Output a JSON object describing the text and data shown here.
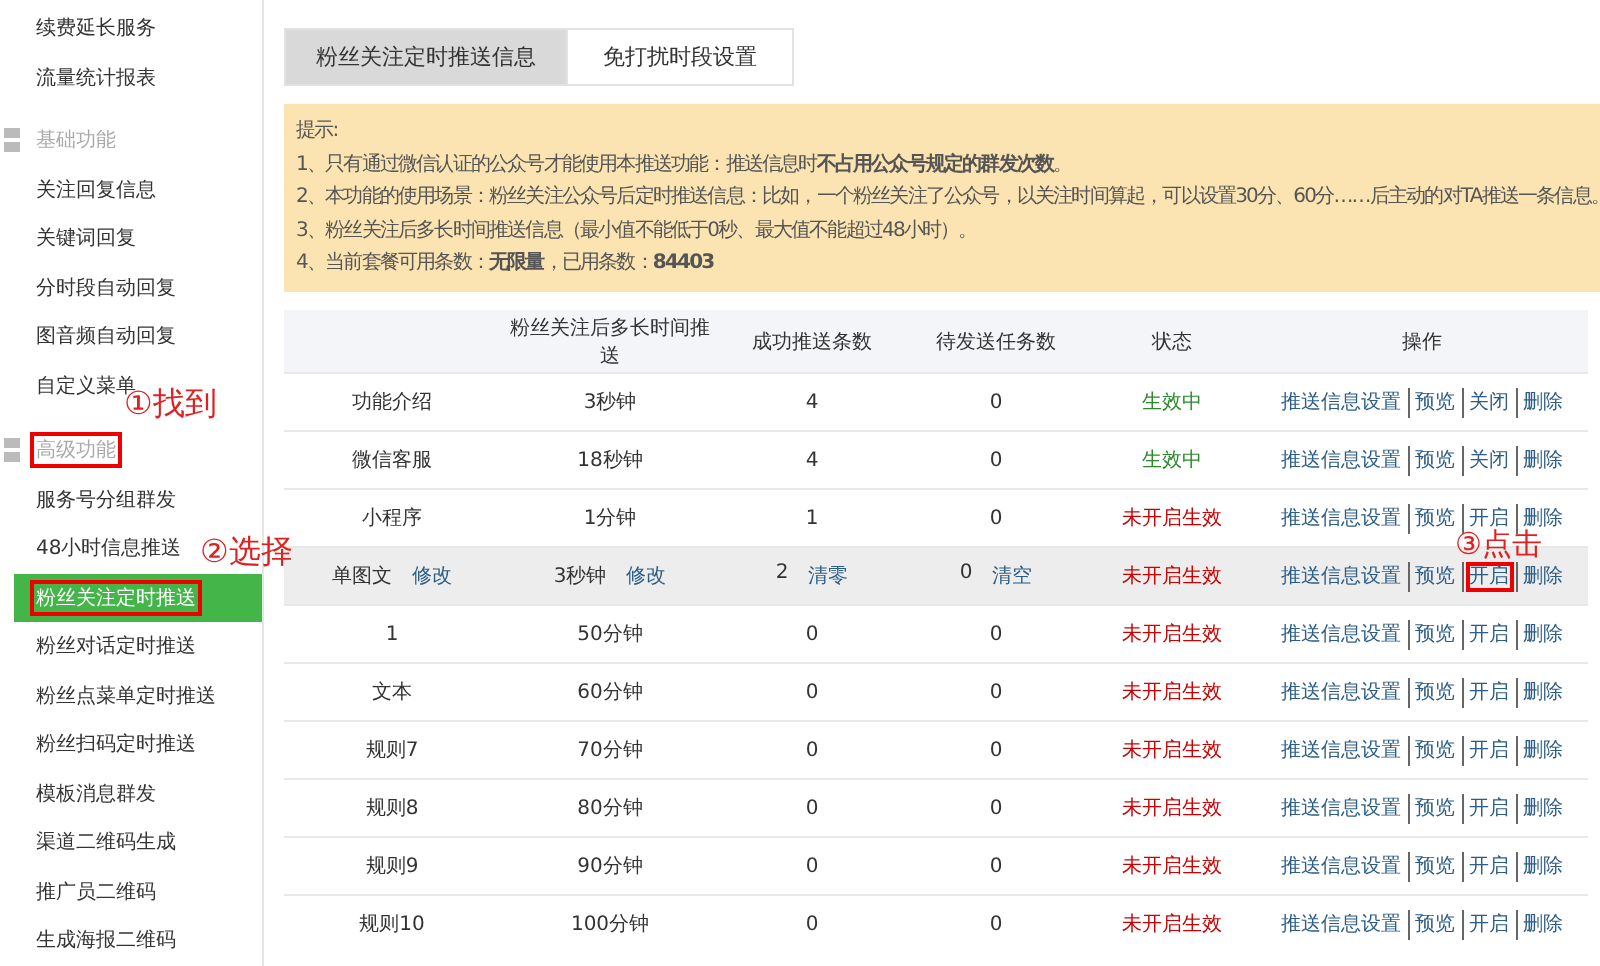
{
  "sidebar": {
    "groups": [
      {
        "items": [
          {
            "label": "续费延长服务",
            "selected": false,
            "highlighted": false
          },
          {
            "label": "流量统计报表",
            "selected": false,
            "highlighted": false
          }
        ]
      },
      {
        "title": "基础功能",
        "highlighted": false,
        "items": [
          {
            "label": "关注回复信息",
            "selected": false,
            "highlighted": false
          },
          {
            "label": "关键词回复",
            "selected": false,
            "highlighted": false
          },
          {
            "label": "分时段自动回复",
            "selected": false,
            "highlighted": false
          },
          {
            "label": "图音频自动回复",
            "selected": false,
            "highlighted": false
          },
          {
            "label": "自定义菜单",
            "selected": false,
            "highlighted": false
          }
        ]
      },
      {
        "title": "高级功能",
        "highlighted": true,
        "callout": "①找到",
        "items": [
          {
            "label": "服务号分组群发",
            "selected": false,
            "highlighted": false
          },
          {
            "label": "48小时信息推送",
            "selected": false,
            "highlighted": false
          },
          {
            "label": "粉丝关注定时推送",
            "selected": true,
            "highlighted": true,
            "callout": "②选择"
          },
          {
            "label": "粉丝对话定时推送",
            "selected": false,
            "highlighted": false
          },
          {
            "label": "粉丝点菜单定时推送",
            "selected": false,
            "highlighted": false
          },
          {
            "label": "粉丝扫码定时推送",
            "selected": false,
            "highlighted": false
          },
          {
            "label": "模板消息群发",
            "selected": false,
            "highlighted": false
          },
          {
            "label": "渠道二维码生成",
            "selected": false,
            "highlighted": false
          },
          {
            "label": "推广员二维码",
            "selected": false,
            "highlighted": false
          },
          {
            "label": "生成海报二维码",
            "selected": false,
            "highlighted": false
          }
        ]
      }
    ]
  },
  "tabs": [
    {
      "label": "粉丝关注定时推送信息",
      "selected": true
    },
    {
      "label": "免打扰时段设置",
      "selected": false
    }
  ],
  "notice": {
    "title": "提示:",
    "lines": [
      "1、只有通过微信认证的公众号才能使用本推送功能：推送信息时**不占用公众号规定的群发次数**。",
      "2、本功能的使用场景：粉丝关注公众号后定时推送信息：比如，一个粉丝关注了公众号，以关注时间算起，可以设置30分、60分……后主动的对TA推送一条信息。",
      "3、粉丝关注后多长时间推送信息（最小值不能低于0秒、最大值不能超过48小时）。",
      "4、当前套餐可用条数：**无限量**，已用条数：**84403**"
    ]
  },
  "table": {
    "columns": [
      "",
      "粉丝关注后多长时间推送",
      "成功推送条数",
      "待发送任务数",
      "状态",
      "操作"
    ],
    "rows": [
      {
        "name": "功能介绍",
        "delay": "3秒钟",
        "success": "4",
        "pending": "0",
        "status": "生效中",
        "active": true,
        "hovered": false,
        "actions": [
          {
            "label": "推送信息设置",
            "highlighted": false
          },
          {
            "label": "预览",
            "highlighted": false
          },
          {
            "label": "关闭",
            "highlighted": false
          },
          {
            "label": "删除",
            "highlighted": false
          }
        ]
      },
      {
        "name": "微信客服",
        "delay": "18秒钟",
        "success": "4",
        "pending": "0",
        "status": "生效中",
        "active": true,
        "hovered": false,
        "actions": [
          {
            "label": "推送信息设置",
            "highlighted": false
          },
          {
            "label": "预览",
            "highlighted": false
          },
          {
            "label": "关闭",
            "highlighted": false
          },
          {
            "label": "删除",
            "highlighted": false
          }
        ]
      },
      {
        "name": "小程序",
        "delay": "1分钟",
        "success": "1",
        "pending": "0",
        "status": "未开启生效",
        "active": false,
        "hovered": false,
        "actions": [
          {
            "label": "推送信息设置",
            "highlighted": false
          },
          {
            "label": "预览",
            "highlighted": false
          },
          {
            "label": "开启",
            "highlighted": false
          },
          {
            "label": "删除",
            "highlighted": false
          }
        ]
      },
      {
        "name": "单图文",
        "name_link": "修改",
        "delay": "3秒钟",
        "delay_link": "修改",
        "success": "2",
        "success_link": "清零",
        "pending": "0",
        "pending_link": "清空",
        "status": "未开启生效",
        "active": false,
        "hovered": true,
        "actions": [
          {
            "label": "推送信息设置",
            "highlighted": false
          },
          {
            "label": "预览",
            "highlighted": false
          },
          {
            "label": "开启",
            "highlighted": true,
            "callout": "③点击"
          },
          {
            "label": "删除",
            "highlighted": false
          }
        ]
      },
      {
        "name": "1",
        "delay": "50分钟",
        "success": "0",
        "pending": "0",
        "status": "未开启生效",
        "active": false,
        "hovered": false,
        "actions": [
          {
            "label": "推送信息设置",
            "highlighted": false
          },
          {
            "label": "预览",
            "highlighted": false
          },
          {
            "label": "开启",
            "highlighted": false
          },
          {
            "label": "删除",
            "highlighted": false
          }
        ]
      },
      {
        "name": "文本",
        "delay": "60分钟",
        "success": "0",
        "pending": "0",
        "status": "未开启生效",
        "active": false,
        "hovered": false,
        "actions": [
          {
            "label": "推送信息设置",
            "highlighted": false
          },
          {
            "label": "预览",
            "highlighted": false
          },
          {
            "label": "开启",
            "highlighted": false
          },
          {
            "label": "删除",
            "highlighted": false
          }
        ]
      },
      {
        "name": "规则7",
        "delay": "70分钟",
        "success": "0",
        "pending": "0",
        "status": "未开启生效",
        "active": false,
        "hovered": false,
        "actions": [
          {
            "label": "推送信息设置",
            "highlighted": false
          },
          {
            "label": "预览",
            "highlighted": false
          },
          {
            "label": "开启",
            "highlighted": false
          },
          {
            "label": "删除",
            "highlighted": false
          }
        ]
      },
      {
        "name": "规则8",
        "delay": "80分钟",
        "success": "0",
        "pending": "0",
        "status": "未开启生效",
        "active": false,
        "hovered": false,
        "actions": [
          {
            "label": "推送信息设置",
            "highlighted": false
          },
          {
            "label": "预览",
            "highlighted": false
          },
          {
            "label": "开启",
            "highlighted": false
          },
          {
            "label": "删除",
            "highlighted": false
          }
        ]
      },
      {
        "name": "规则9",
        "delay": "90分钟",
        "success": "0",
        "pending": "0",
        "status": "未开启生效",
        "active": false,
        "hovered": false,
        "actions": [
          {
            "label": "推送信息设置",
            "highlighted": false
          },
          {
            "label": "预览",
            "highlighted": false
          },
          {
            "label": "开启",
            "highlighted": false
          },
          {
            "label": "删除",
            "highlighted": false
          }
        ]
      },
      {
        "name": "规则10",
        "delay": "100分钟",
        "success": "0",
        "pending": "0",
        "status": "未开启生效",
        "active": false,
        "hovered": false,
        "actions": [
          {
            "label": "推送信息设置",
            "highlighted": false
          },
          {
            "label": "预览",
            "highlighted": false
          },
          {
            "label": "开启",
            "highlighted": false
          },
          {
            "label": "删除",
            "highlighted": false
          }
        ]
      }
    ]
  }
}
